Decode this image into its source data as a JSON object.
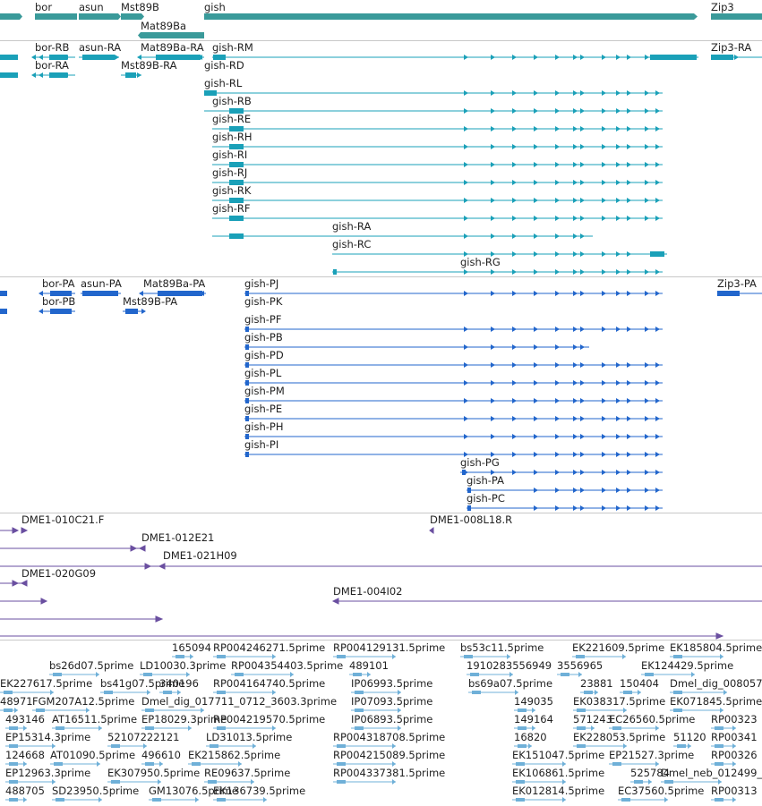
{
  "genes_track": {
    "labels": [
      "bor",
      "asun",
      "Mst89B",
      "gish",
      "Zip3",
      "Mat89Ba"
    ],
    "color": "#2e8b8b"
  },
  "transcripts_track": {
    "color": "#1aa0b8",
    "labels": [
      "bor-RB",
      "asun-RA",
      "Mat89Ba-RA",
      "gish-RM",
      "Zip3-RA",
      "bor-RA",
      "Mst89B-RA",
      "gish-RD",
      "gish-RL",
      "gish-RB",
      "gish-RE",
      "gish-RH",
      "gish-RI",
      "gish-RJ",
      "gish-RK",
      "gish-RF",
      "gish-RA",
      "gish-RC",
      "gish-RG"
    ]
  },
  "proteins_track": {
    "color": "#2266cc",
    "labels": [
      "bor-PA",
      "asun-PA",
      "Mat89Ba-PA",
      "gish-PJ",
      "Zip3-PA",
      "bor-PB",
      "Mst89B-PA",
      "gish-PK",
      "gish-PF",
      "gish-PB",
      "gish-PD",
      "gish-PL",
      "gish-PM",
      "gish-PE",
      "gish-PH",
      "gish-PI",
      "gish-PG",
      "gish-PA",
      "gish-PC"
    ]
  },
  "clones_track": {
    "color": "#6a4fa0",
    "labels": [
      "DME1-010C21.F",
      "DME1-008L18.R",
      "DME1-012E21",
      "DME1-021H09",
      "DME1-020G09",
      "DME1-004I02"
    ]
  },
  "ests_track": {
    "color": "#6fb0d8",
    "labels": [
      "165094",
      "RP004246271.5prime",
      "RP004129131.5prime",
      "bs53c11.5prime",
      "EK221609.5prime",
      "EK185804.5prime",
      "bs26d07.5prime",
      "LD10030.3prime",
      "RP004354403.5prime",
      "489101",
      "1910283556949",
      "3556965",
      "EK124429.5prime",
      "EK227617.5prime",
      "bs41g07.5prime",
      "340196",
      "RP004164740.5prime",
      "IP06993.5prime",
      "bs69a07.5prime",
      "23881",
      "150404",
      "Dmel_dig_008057_",
      "48971",
      "FGM207A12.5prime",
      "Dmel_dig_017711_0712_3603.3prime",
      "IP07093.5prime",
      "149035",
      "EK038317.5prime",
      "EK071845.5prime",
      "493146",
      "AT16511.5prime",
      "EP18029.3prime",
      "RP004219570.5prime",
      "IP06893.5prime",
      "149164",
      "571243",
      "EC26560.5prime",
      "RP00323",
      "EP15314.3prime",
      "52107222121",
      "LD31013.5prime",
      "RP004318708.5prime",
      "16820",
      "EK228053.5prime",
      "51120",
      "RP00341",
      "124668",
      "AT01090.5prime",
      "496610",
      "EK215862.5prime",
      "RP004215089.5prime",
      "EK151047.5prime",
      "EP21527.3prime",
      "RP00326",
      "EP12963.3prime",
      "EK307950.5prime",
      "RE09637.5prime",
      "RP004337381.5prime",
      "EK106861.5prime",
      "525784",
      "Dmel_neb_012499_0",
      "488705",
      "SD23950.5prime",
      "GM13076.5prime",
      "EK136739.5prime",
      "EK012814.5prime",
      "EC37560.5prime",
      "RP00313"
    ]
  }
}
